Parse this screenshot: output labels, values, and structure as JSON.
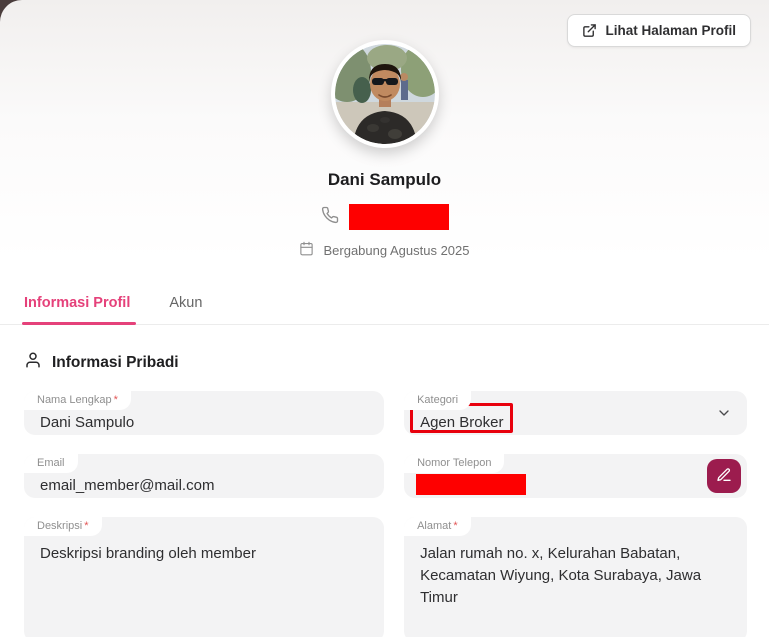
{
  "ui": {
    "required_marker": "*"
  },
  "header": {
    "view_profile_button": "Lihat Halaman Profil"
  },
  "profile": {
    "name": "Dani Sampulo",
    "joined": "Bergabung Agustus 2025"
  },
  "tabs": [
    {
      "label": "Informasi Profil",
      "active": true
    },
    {
      "label": "Akun",
      "active": false
    }
  ],
  "section": {
    "title": "Informasi Pribadi"
  },
  "form": {
    "fields": {
      "nama": {
        "label": "Nama Lengkap",
        "required": true,
        "value": "Dani Sampulo"
      },
      "kategori": {
        "label": "Kategori",
        "required": false,
        "value": "Agen Broker"
      },
      "email": {
        "label": "Email",
        "required": false,
        "value": "email_member@mail.com"
      },
      "telepon": {
        "label": "Nomor Telepon",
        "required": false,
        "value": ""
      },
      "deskripsi": {
        "label": "Deskripsi",
        "required": true,
        "value": "Deskripsi branding oleh member"
      },
      "alamat": {
        "label": "Alamat",
        "required": true,
        "value": "Jalan rumah no. x, Kelurahan Babatan, Kecamatan Wiyung, Kota Surabaya, Jawa Timur"
      }
    }
  },
  "icons": {
    "external_link": "external-link-icon",
    "phone": "phone-icon",
    "calendar": "calendar-icon",
    "person": "person-icon",
    "chevron_down": "chevron-down-icon",
    "pencil": "pencil-icon"
  },
  "colors": {
    "accent": "#e5417a",
    "edit_button": "#9c1c4e",
    "redaction": "#fe0000",
    "annotation": "#e8000d",
    "field_bg": "#f3f3f4"
  }
}
